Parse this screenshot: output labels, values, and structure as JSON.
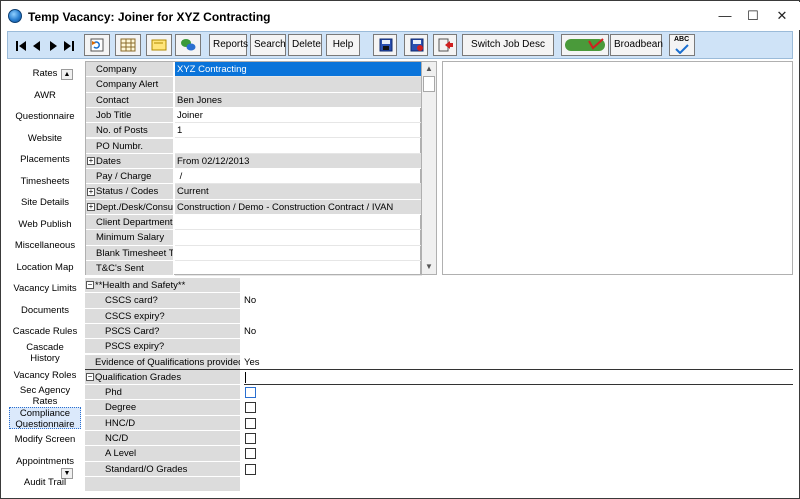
{
  "window": {
    "title": "Temp Vacancy: Joiner for XYZ Contracting",
    "controls": {
      "minimize": "—",
      "maximize": "☐",
      "close": "✕"
    }
  },
  "toolbar": {
    "reports": "Reports",
    "search": "Search",
    "delete": "Delete",
    "help": "Help",
    "switch_job_desc": "Switch Job Desc",
    "broadbean": "Broadbean",
    "spell_label": "ABC"
  },
  "leftnav": {
    "items": [
      "Rates",
      "AWR",
      "Questionnaire",
      "Website",
      "Placements",
      "Timesheets",
      "Site Details",
      "Web Publish",
      "Miscellaneous",
      "Location Map",
      "Vacancy Limits",
      "Documents",
      "Cascade Rules",
      "Cascade\nHistory",
      "Vacancy Roles",
      "Sec Agency\nRates",
      "Compliance\nQuestionnaire",
      "Modify Screen",
      "Appointments",
      "Audit Trail"
    ]
  },
  "details": {
    "rows": [
      {
        "label": "Company",
        "value": "XYZ Contracting"
      },
      {
        "label": "Company Alert",
        "value": ""
      },
      {
        "label": "Contact",
        "value": "Ben Jones"
      },
      {
        "label": "Job Title",
        "value": "Joiner"
      },
      {
        "label": "No. of Posts",
        "value": "1"
      },
      {
        "label": "PO Numbr.",
        "value": ""
      },
      {
        "label": "Dates",
        "value": "From 02/12/2013",
        "expander": "+"
      },
      {
        "label": "Pay / Charge",
        "value": " /"
      },
      {
        "label": "Status / Codes",
        "value": "Current",
        "expander": "+"
      },
      {
        "label": "Dept./Desk/Consul",
        "value": "Construction / Demo - Construction Contract / IVAN",
        "expander": "+"
      },
      {
        "label": "Client Department",
        "value": ""
      },
      {
        "label": "Minimum Salary",
        "value": ""
      },
      {
        "label": "Blank Timesheet Ty",
        "value": ""
      },
      {
        "label": "T&C's Sent",
        "value": ""
      }
    ]
  },
  "health_safety": {
    "header": "**Health and Safety**",
    "expander": "−",
    "rows": [
      {
        "label": "CSCS card?",
        "value": "No"
      },
      {
        "label": "CSCS expiry?",
        "value": ""
      },
      {
        "label": "PSCS Card?",
        "value": "No"
      },
      {
        "label": "PSCS expiry?",
        "value": ""
      },
      {
        "label": "Evidence of Qualifications provided",
        "value": "Yes"
      }
    ]
  },
  "qualification_grades": {
    "header": "Qualification Grades",
    "expander": "−",
    "rows": [
      {
        "label": "Phd",
        "checked": false
      },
      {
        "label": "Degree",
        "checked": false
      },
      {
        "label": "HNC/D",
        "checked": false
      },
      {
        "label": "NC/D",
        "checked": false
      },
      {
        "label": "A Level",
        "checked": false
      },
      {
        "label": "Standard/O Grades",
        "checked": false
      }
    ]
  }
}
